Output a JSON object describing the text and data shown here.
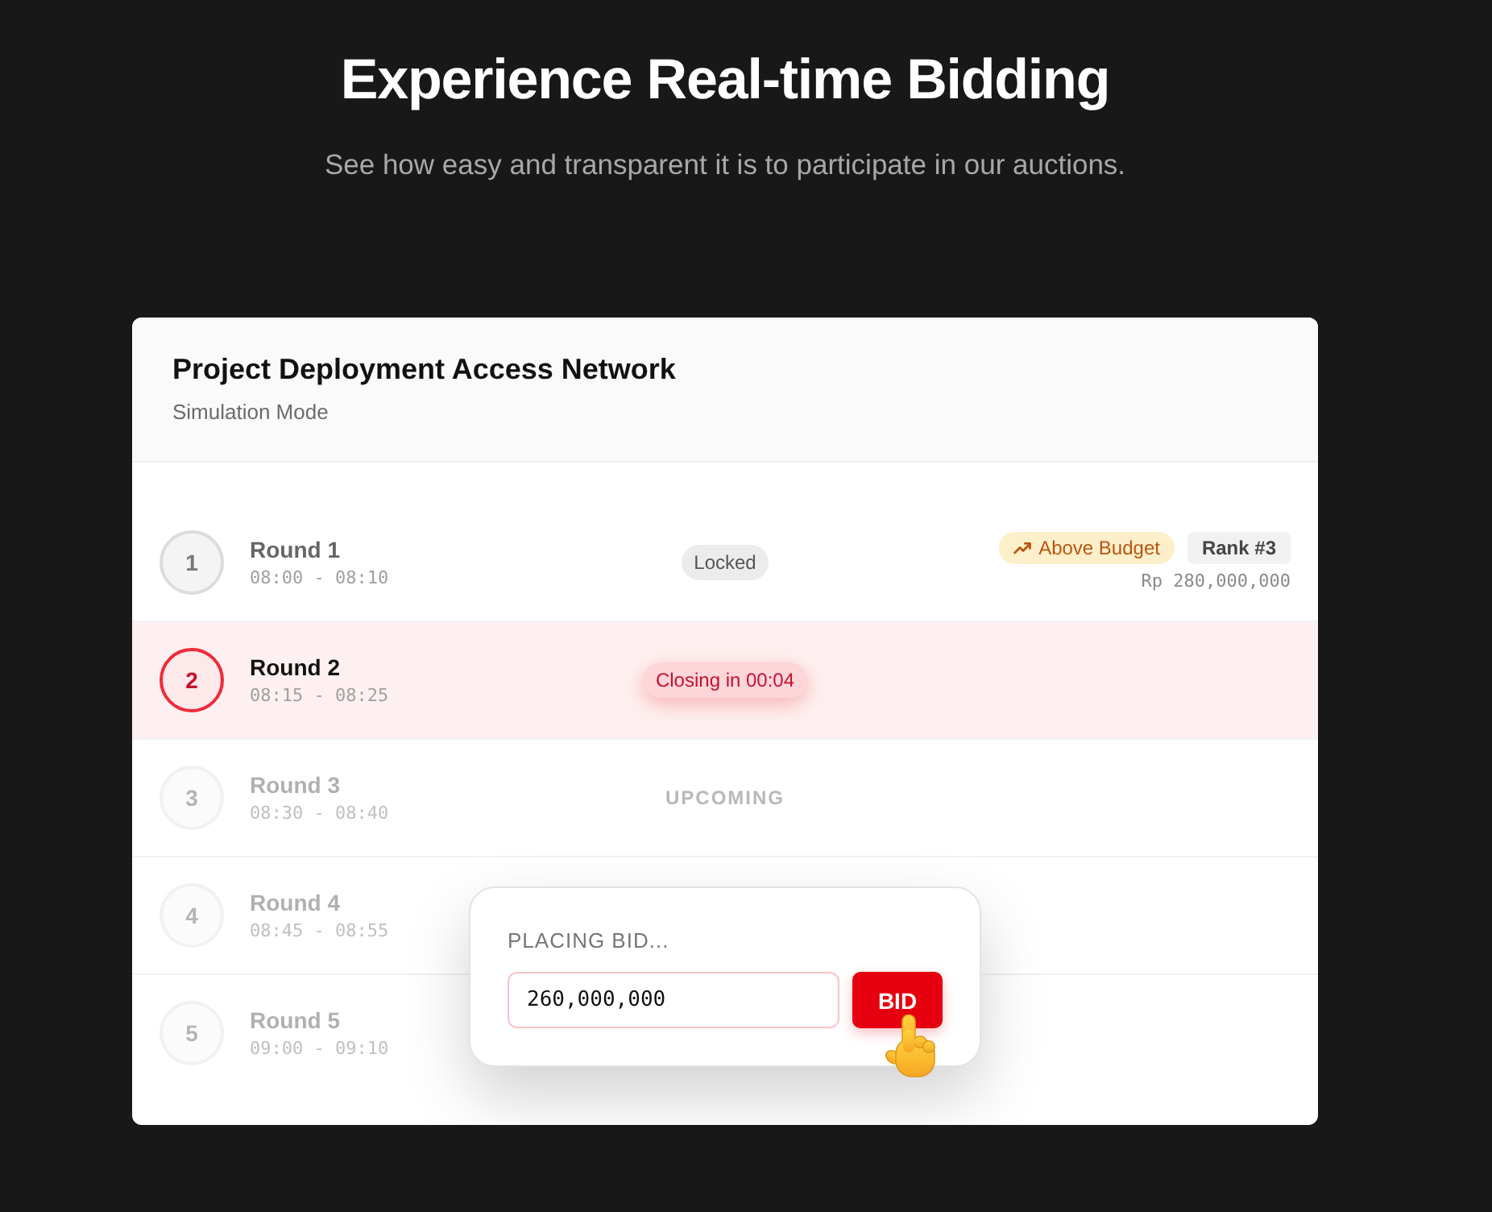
{
  "hero": {
    "title": "Experience Real-time Bidding",
    "subtitle": "See how easy and transparent it is to participate in our auctions."
  },
  "card": {
    "title": "Project Deployment Access Network",
    "subtitle": "Simulation Mode"
  },
  "rounds": [
    {
      "number": "1",
      "name": "Round 1",
      "time": "08:00 - 08:10",
      "kind": "locked",
      "status": {
        "kind": "pill",
        "text": "Locked"
      },
      "tags": [
        {
          "kind": "budget",
          "text": "Above Budget"
        },
        {
          "kind": "rank",
          "text": "Rank #3"
        }
      ],
      "amount": "Rp 280,000,000"
    },
    {
      "number": "2",
      "name": "Round 2",
      "time": "08:15 - 08:25",
      "kind": "active",
      "status": {
        "kind": "timer",
        "text": "Closing in 00:04"
      }
    },
    {
      "number": "3",
      "name": "Round 3",
      "time": "08:30 - 08:40",
      "kind": "upcoming",
      "status": {
        "kind": "label",
        "text": "UPCOMING"
      }
    },
    {
      "number": "4",
      "name": "Round 4",
      "time": "08:45 - 08:55",
      "kind": "upcoming"
    },
    {
      "number": "5",
      "name": "Round 5",
      "time": "09:00 - 09:10",
      "kind": "upcoming"
    }
  ],
  "bid_popup": {
    "label": "PLACING BID...",
    "value": "260,000,000",
    "button": "BID"
  }
}
